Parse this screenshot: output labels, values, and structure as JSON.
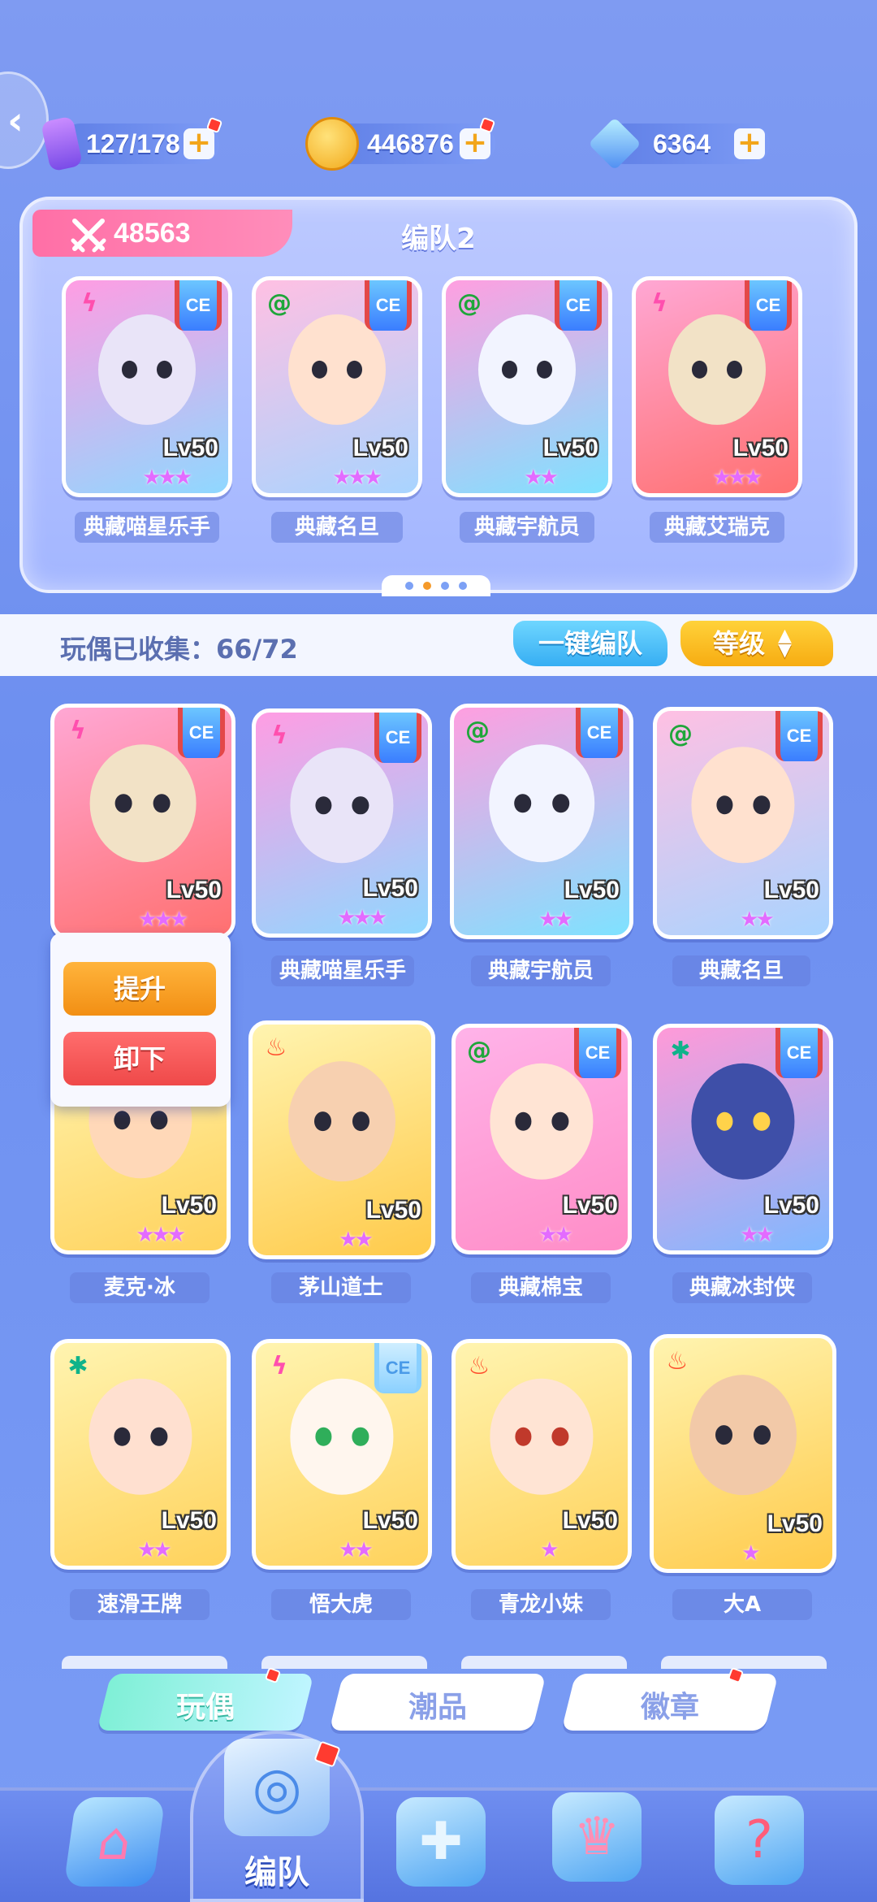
{
  "currency": {
    "stamina": "127/178",
    "coins": "446876",
    "gems": "6364"
  },
  "team": {
    "power": "48563",
    "name": "编队2",
    "members": [
      {
        "name": "典藏喵星乐手",
        "level": "Lv50",
        "element": "lightning",
        "stars": "★★★"
      },
      {
        "name": "典藏名旦",
        "level": "Lv50",
        "element": "wind",
        "stars": "★★★"
      },
      {
        "name": "典藏宇航员",
        "level": "Lv50",
        "element": "wind",
        "stars": "★★"
      },
      {
        "name": "典藏艾瑞克",
        "level": "Lv50",
        "element": "lightning",
        "stars": "★★★"
      }
    ],
    "badge": "CE"
  },
  "collection": {
    "label": "玩偶已收集：66/72",
    "auto_button": "一键编队",
    "sort_button": "等级"
  },
  "popup": {
    "upgrade": "提升",
    "unequip": "卸下"
  },
  "dolls": [
    {
      "name": "",
      "level": "Lv50",
      "stars": "★★★"
    },
    {
      "name": "典藏喵星乐手",
      "level": "Lv50",
      "stars": "★★★"
    },
    {
      "name": "典藏宇航员",
      "level": "Lv50",
      "stars": "★★"
    },
    {
      "name": "典藏名旦",
      "level": "Lv50",
      "stars": "★★"
    },
    {
      "name": "麦克·冰",
      "level": "Lv50",
      "stars": "★★★"
    },
    {
      "name": "茅山道士",
      "level": "Lv50",
      "stars": "★★"
    },
    {
      "name": "典藏棉宝",
      "level": "Lv50",
      "stars": "★★"
    },
    {
      "name": "典藏冰封侠",
      "level": "Lv50",
      "stars": "★★"
    },
    {
      "name": "速滑王牌",
      "level": "Lv50",
      "stars": "★★"
    },
    {
      "name": "悟大虎",
      "level": "Lv50",
      "stars": "★★"
    },
    {
      "name": "青龙小妹",
      "level": "Lv50",
      "stars": "★"
    },
    {
      "name": "大A",
      "level": "Lv50",
      "stars": "★"
    }
  ],
  "tabs": [
    {
      "label": "玩偶",
      "active": true
    },
    {
      "label": "潮品",
      "active": false
    },
    {
      "label": "徽章",
      "active": false
    }
  ],
  "nav": {
    "active_label": "编队"
  },
  "colors": {
    "accent_pink": "#ff6fa6",
    "accent_blue": "#36aef3",
    "accent_yellow": "#f7ac12",
    "bg": "#7f9bf2"
  }
}
